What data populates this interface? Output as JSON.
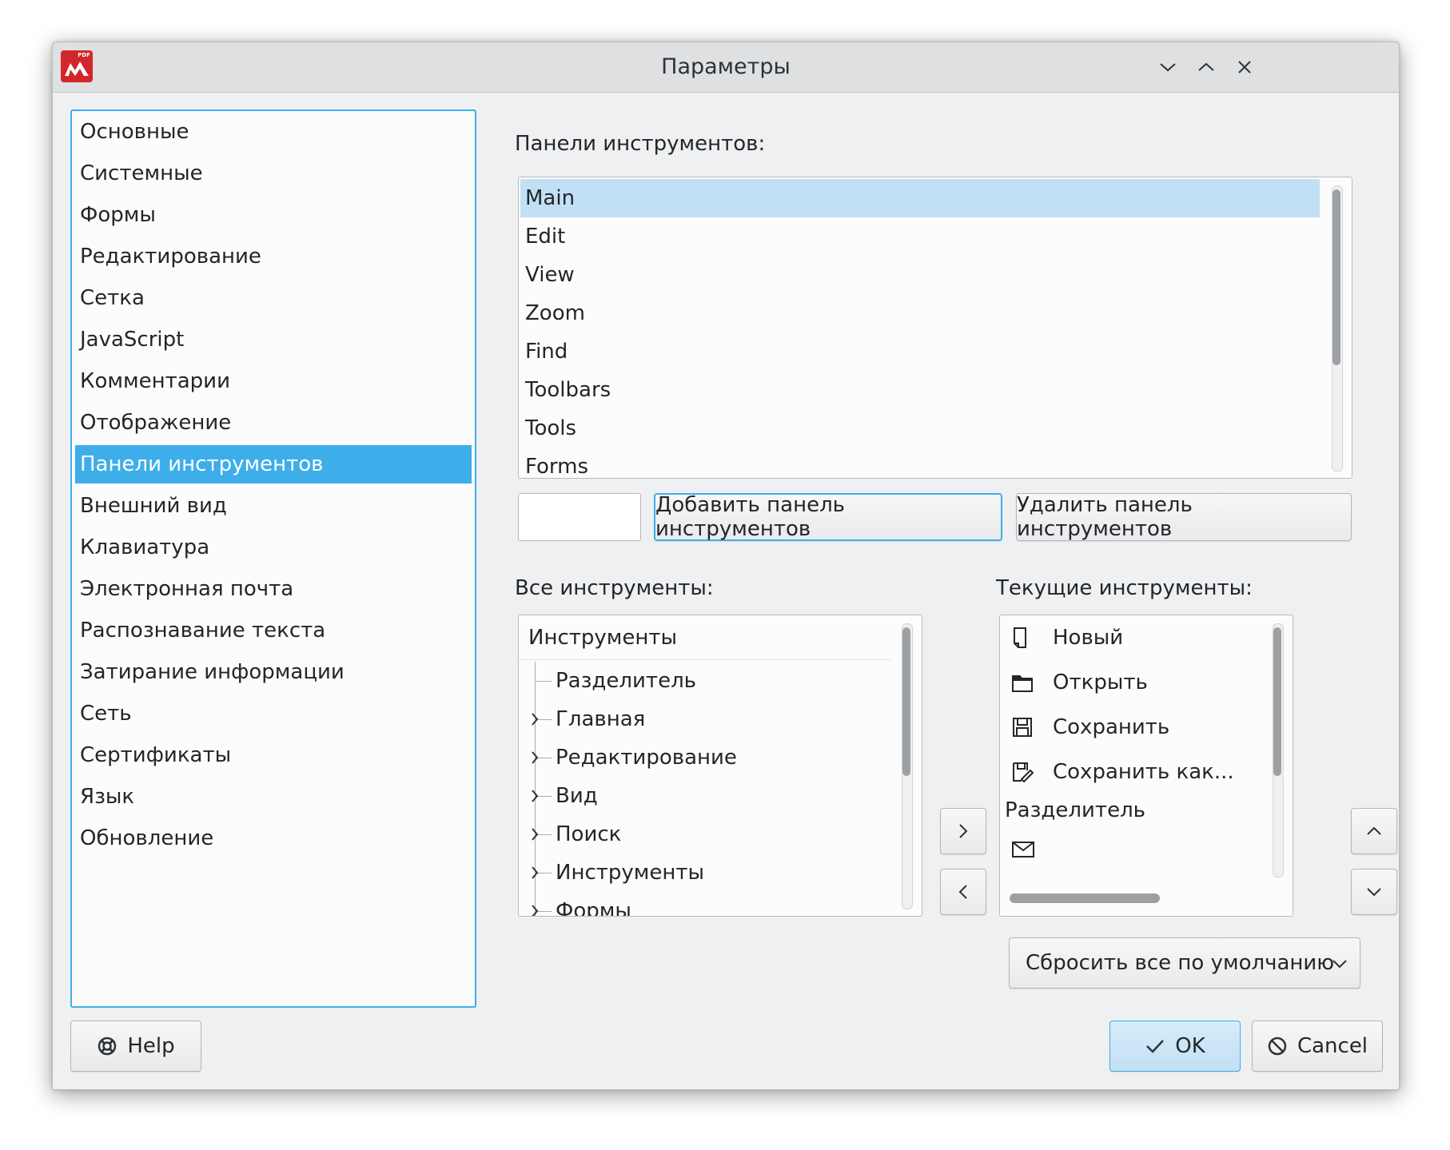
{
  "window": {
    "title": "Параметры",
    "app_badge": "PDF"
  },
  "nav": {
    "items": [
      {
        "label": "Основные"
      },
      {
        "label": "Системные"
      },
      {
        "label": "Формы"
      },
      {
        "label": "Редактирование"
      },
      {
        "label": "Сетка"
      },
      {
        "label": "JavaScript"
      },
      {
        "label": "Комментарии"
      },
      {
        "label": "Отображение"
      },
      {
        "label": "Панели инструментов"
      },
      {
        "label": "Внешний вид"
      },
      {
        "label": "Клавиатура"
      },
      {
        "label": "Электронная почта"
      },
      {
        "label": "Распознавание текста"
      },
      {
        "label": "Затирание информации"
      },
      {
        "label": "Сеть"
      },
      {
        "label": "Сертификаты"
      },
      {
        "label": "Язык"
      },
      {
        "label": "Обновление"
      }
    ],
    "selected_index": 8
  },
  "toolbars": {
    "label": "Панели инструментов:",
    "items": [
      "Main",
      "Edit",
      "View",
      "Zoom",
      "Find",
      "Toolbars",
      "Tools",
      "Forms"
    ],
    "selected": "Main",
    "name_input_value": "",
    "add_label": "Добавить панель инструментов",
    "remove_label": "Удалить панель инструментов"
  },
  "all_tools": {
    "label": "Все инструменты:",
    "header": "Инструменты",
    "items": [
      "Разделитель",
      "Главная",
      "Редактирование",
      "Вид",
      "Поиск",
      "Инструменты",
      "Формы"
    ]
  },
  "current_tools": {
    "label": "Текущие инструменты:",
    "items": [
      {
        "label": "Новый",
        "icon": "new-document-icon"
      },
      {
        "label": "Открыть",
        "icon": "open-folder-icon"
      },
      {
        "label": "Сохранить",
        "icon": "save-icon"
      },
      {
        "label": "Сохранить как...",
        "icon": "save-as-icon"
      },
      {
        "label": "Разделитель",
        "icon": ""
      },
      {
        "label": "",
        "icon": "email-icon"
      }
    ]
  },
  "transfer": {
    "add_glyph": ">",
    "remove_glyph": "<"
  },
  "order": {
    "up_glyph": "∧",
    "down_glyph": "∨"
  },
  "reset_label": "Сбросить все по умолчанию",
  "footer": {
    "help_label": "Help",
    "ok_label": "OK",
    "cancel_label": "Cancel"
  },
  "colors": {
    "accent": "#3daee9",
    "selection_light": "#c2e0f5",
    "window_bg": "#eff0f1"
  }
}
